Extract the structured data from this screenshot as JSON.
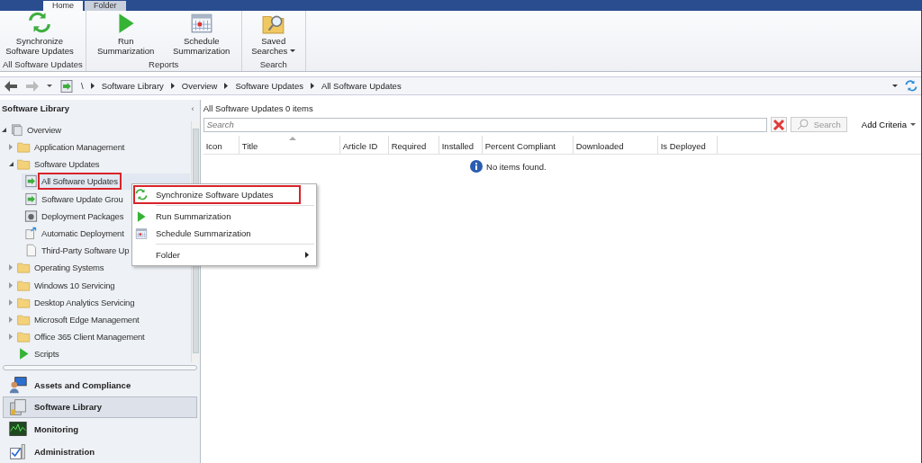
{
  "ribbon_tabs": [
    {
      "label": "Home",
      "selected": true
    },
    {
      "label": "Folder",
      "selected": false
    }
  ],
  "ribbon_groups": [
    {
      "label": "All Software Updates",
      "buttons": [
        {
          "label": "Synchronize Software Updates",
          "kind": "sync",
          "dropdown": false
        }
      ]
    },
    {
      "label": "Reports",
      "buttons": [
        {
          "label": "Run Summarization",
          "kind": "run",
          "dropdown": false
        },
        {
          "label": "Schedule Summarization",
          "kind": "calendar",
          "dropdown": false
        }
      ]
    },
    {
      "label": "Search",
      "buttons": [
        {
          "label": "Saved Searches",
          "kind": "searchfolder",
          "dropdown": true
        }
      ]
    }
  ],
  "breadcrumb": [
    "\\",
    "Software Library",
    "Overview",
    "Software Updates",
    "All Software Updates"
  ],
  "navigation": {
    "title": "Software Library",
    "collapse_button": "‹",
    "tree": [
      {
        "label": "Overview",
        "kind": "overview",
        "expanded": true,
        "selected": false,
        "children": [
          {
            "label": "Application Management",
            "kind": "folder",
            "expanded": false,
            "selected": false
          },
          {
            "label": "Software Updates",
            "kind": "folder",
            "expanded": true,
            "selected": false,
            "children": [
              {
                "label": "All Software Updates",
                "kind": "update",
                "selected": true,
                "highlighted": true
              },
              {
                "label": "Software Update Grou",
                "kind": "update",
                "selected": false
              },
              {
                "label": "Deployment Packages",
                "kind": "package",
                "selected": false
              },
              {
                "label": "Automatic Deployment",
                "kind": "rule",
                "selected": false
              },
              {
                "label": "Third-Party Software Up",
                "kind": "document",
                "selected": false
              }
            ]
          },
          {
            "label": "Operating Systems",
            "kind": "folder",
            "expanded": false,
            "selected": false
          },
          {
            "label": "Windows 10 Servicing",
            "kind": "folder",
            "expanded": false,
            "selected": false
          },
          {
            "label": "Desktop Analytics Servicing",
            "kind": "folder",
            "expanded": false,
            "selected": false
          },
          {
            "label": "Microsoft Edge Management",
            "kind": "folder",
            "expanded": false,
            "selected": false
          },
          {
            "label": "Office 365 Client Management",
            "kind": "folder",
            "expanded": false,
            "selected": false
          },
          {
            "label": "Scripts",
            "kind": "run",
            "selected": false
          }
        ]
      }
    ]
  },
  "workspaces": [
    {
      "label": "Assets and Compliance",
      "kind": "assets",
      "selected": false
    },
    {
      "label": "Software Library",
      "kind": "library",
      "selected": true
    },
    {
      "label": "Monitoring",
      "kind": "monitor",
      "selected": false
    },
    {
      "label": "Administration",
      "kind": "admin",
      "selected": false
    }
  ],
  "content": {
    "title": "All Software Updates 0 items",
    "search": {
      "placeholder": "Search"
    },
    "search_button": "Search",
    "add_criteria": "Add Criteria",
    "columns": [
      {
        "label": "Icon",
        "sorted": false
      },
      {
        "label": "Title",
        "sorted": true
      },
      {
        "label": "Article ID",
        "sorted": false
      },
      {
        "label": "Required",
        "sorted": false
      },
      {
        "label": "Installed",
        "sorted": false
      },
      {
        "label": "Percent Compliant",
        "sorted": false
      },
      {
        "label": "Downloaded",
        "sorted": false
      },
      {
        "label": "Is Deployed",
        "sorted": false
      }
    ],
    "empty_message": "No items found."
  },
  "context_menu": {
    "items": [
      {
        "kind": "sync",
        "label": "Synchronize Software Updates",
        "highlighted": true
      },
      {
        "kind": "separator"
      },
      {
        "kind": "run",
        "label": "Run Summarization",
        "highlighted": false
      },
      {
        "kind": "calendar",
        "label": "Schedule Summarization",
        "highlighted": false
      },
      {
        "kind": "separator"
      },
      {
        "kind": "submenu",
        "label": "Folder",
        "highlighted": false
      }
    ]
  }
}
